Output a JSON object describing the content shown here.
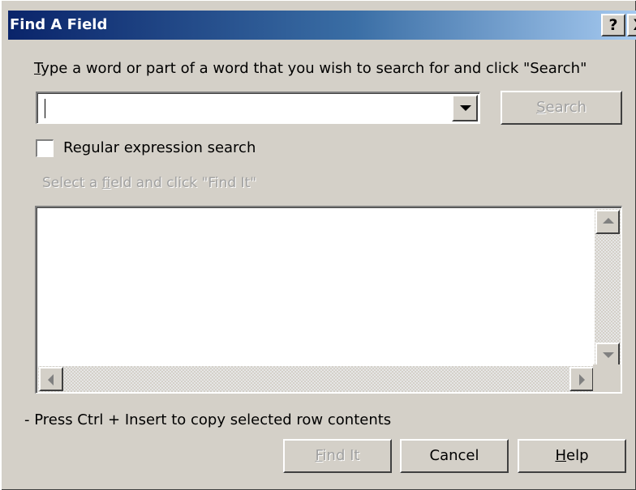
{
  "window": {
    "title": "Find A Field",
    "help_glyph": "?",
    "close_glyph": "X"
  },
  "search": {
    "instruction_hotkey": "T",
    "instruction_rest": "ype a word or part of a word that you wish to search for and click \"Search\"",
    "value": "",
    "search_button_hotkey": "S",
    "search_button_rest": "earch",
    "search_button_enabled": false
  },
  "regex_option": {
    "label": "Regular expression search",
    "checked": false
  },
  "results": {
    "hint_pre": "Select a ",
    "hint_hotkey": "f",
    "hint_post": "ield and click \"Find It\"",
    "items": []
  },
  "footer": {
    "note": "- Press Ctrl + Insert to copy selected row contents",
    "find_it_hotkey": "F",
    "find_it_rest": "ind It",
    "find_it_enabled": false,
    "cancel_label": "Cancel",
    "help_hotkey": "H",
    "help_rest": "elp"
  }
}
